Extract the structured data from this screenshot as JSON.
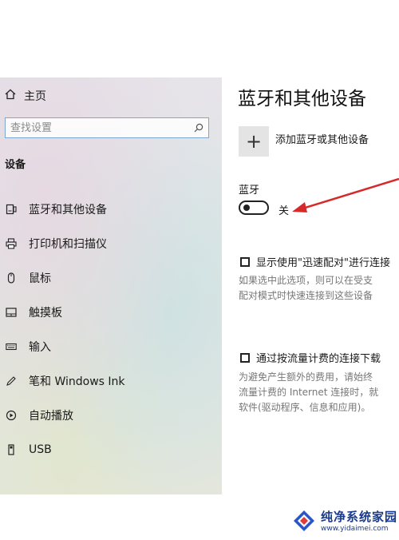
{
  "sidebar": {
    "home_label": "主页",
    "search_placeholder": "查找设置",
    "section_title": "设备",
    "items": [
      {
        "label": "蓝牙和其他设备",
        "icon": "bluetooth-devices-icon"
      },
      {
        "label": "打印机和扫描仪",
        "icon": "printer-icon"
      },
      {
        "label": "鼠标",
        "icon": "mouse-icon"
      },
      {
        "label": "触摸板",
        "icon": "touchpad-icon"
      },
      {
        "label": "输入",
        "icon": "keyboard-icon"
      },
      {
        "label": "笔和 Windows Ink",
        "icon": "pen-icon"
      },
      {
        "label": "自动播放",
        "icon": "autoplay-icon"
      },
      {
        "label": "USB",
        "icon": "usb-icon"
      }
    ]
  },
  "main": {
    "title": "蓝牙和其他设备",
    "add_device_label": "添加蓝牙或其他设备",
    "bluetooth_label": "蓝牙",
    "bluetooth_state": "关",
    "bluetooth_on": false,
    "swift_pair": {
      "label": "显示使用\"迅速配对\"进行连接",
      "checked": false,
      "desc_line1": "如果选中此选项，则可以在受支",
      "desc_line2": "配对模式时快速连接到这些设备"
    },
    "metered": {
      "label": "通过按流量计费的连接下载",
      "checked": false,
      "desc_line1": "为避免产生额外的费用，请始终",
      "desc_line2": "流量计费的 Internet 连接时，就",
      "desc_line3": "软件(驱动程序、信息和应用)。"
    }
  },
  "watermark": {
    "name": "纯净系统家园",
    "url": "www.yidaimei.com"
  },
  "colors": {
    "accent_border": "#7da6d3",
    "arrow": "#d62a2a",
    "watermark": "#1a3b8c"
  }
}
